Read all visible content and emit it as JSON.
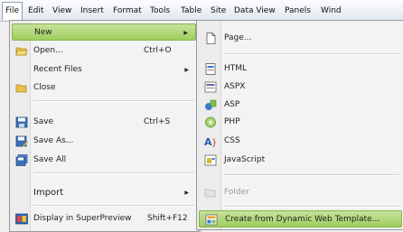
{
  "menubar": {
    "items": [
      {
        "label": "File"
      },
      {
        "label": "Edit"
      },
      {
        "label": "View"
      },
      {
        "label": "Insert"
      },
      {
        "label": "Format"
      },
      {
        "label": "Tools"
      },
      {
        "label": "Table"
      },
      {
        "label": "Site"
      },
      {
        "label": "Data View"
      },
      {
        "label": "Panels"
      },
      {
        "label": "Wind"
      }
    ]
  },
  "file_menu": {
    "items": [
      {
        "label": "New",
        "shortcut": "",
        "icon": "",
        "has_submenu": true
      },
      {
        "label": "Open...",
        "shortcut": "Ctrl+O",
        "icon": "folder-open-icon"
      },
      {
        "label": "Recent Files",
        "shortcut": "",
        "icon": "",
        "has_submenu": true
      },
      {
        "label": "Close",
        "shortcut": "",
        "icon": "folder-close-icon"
      },
      {
        "label": "Save",
        "shortcut": "Ctrl+S",
        "icon": "save-icon"
      },
      {
        "label": "Save As...",
        "shortcut": "",
        "icon": "save-as-icon"
      },
      {
        "label": "Save All",
        "shortcut": "",
        "icon": "save-all-icon"
      },
      {
        "label": "Import",
        "shortcut": "",
        "icon": "",
        "has_submenu": true
      },
      {
        "label": "Display in SuperPreview",
        "shortcut": "Shift+F12",
        "icon": "superpreview-icon"
      }
    ]
  },
  "new_submenu": {
    "items": [
      {
        "label": "Page...",
        "icon": "page-icon"
      },
      {
        "label": "HTML",
        "icon": "html-icon"
      },
      {
        "label": "ASPX",
        "icon": "aspx-icon"
      },
      {
        "label": "ASP",
        "icon": "asp-icon"
      },
      {
        "label": "PHP",
        "icon": "php-icon"
      },
      {
        "label": "CSS",
        "icon": "css-icon"
      },
      {
        "label": "JavaScript",
        "icon": "javascript-icon"
      },
      {
        "label": "Folder",
        "icon": "folder-icon"
      },
      {
        "label": "Create from Dynamic Web Template...",
        "icon": "dwt-icon"
      }
    ]
  }
}
